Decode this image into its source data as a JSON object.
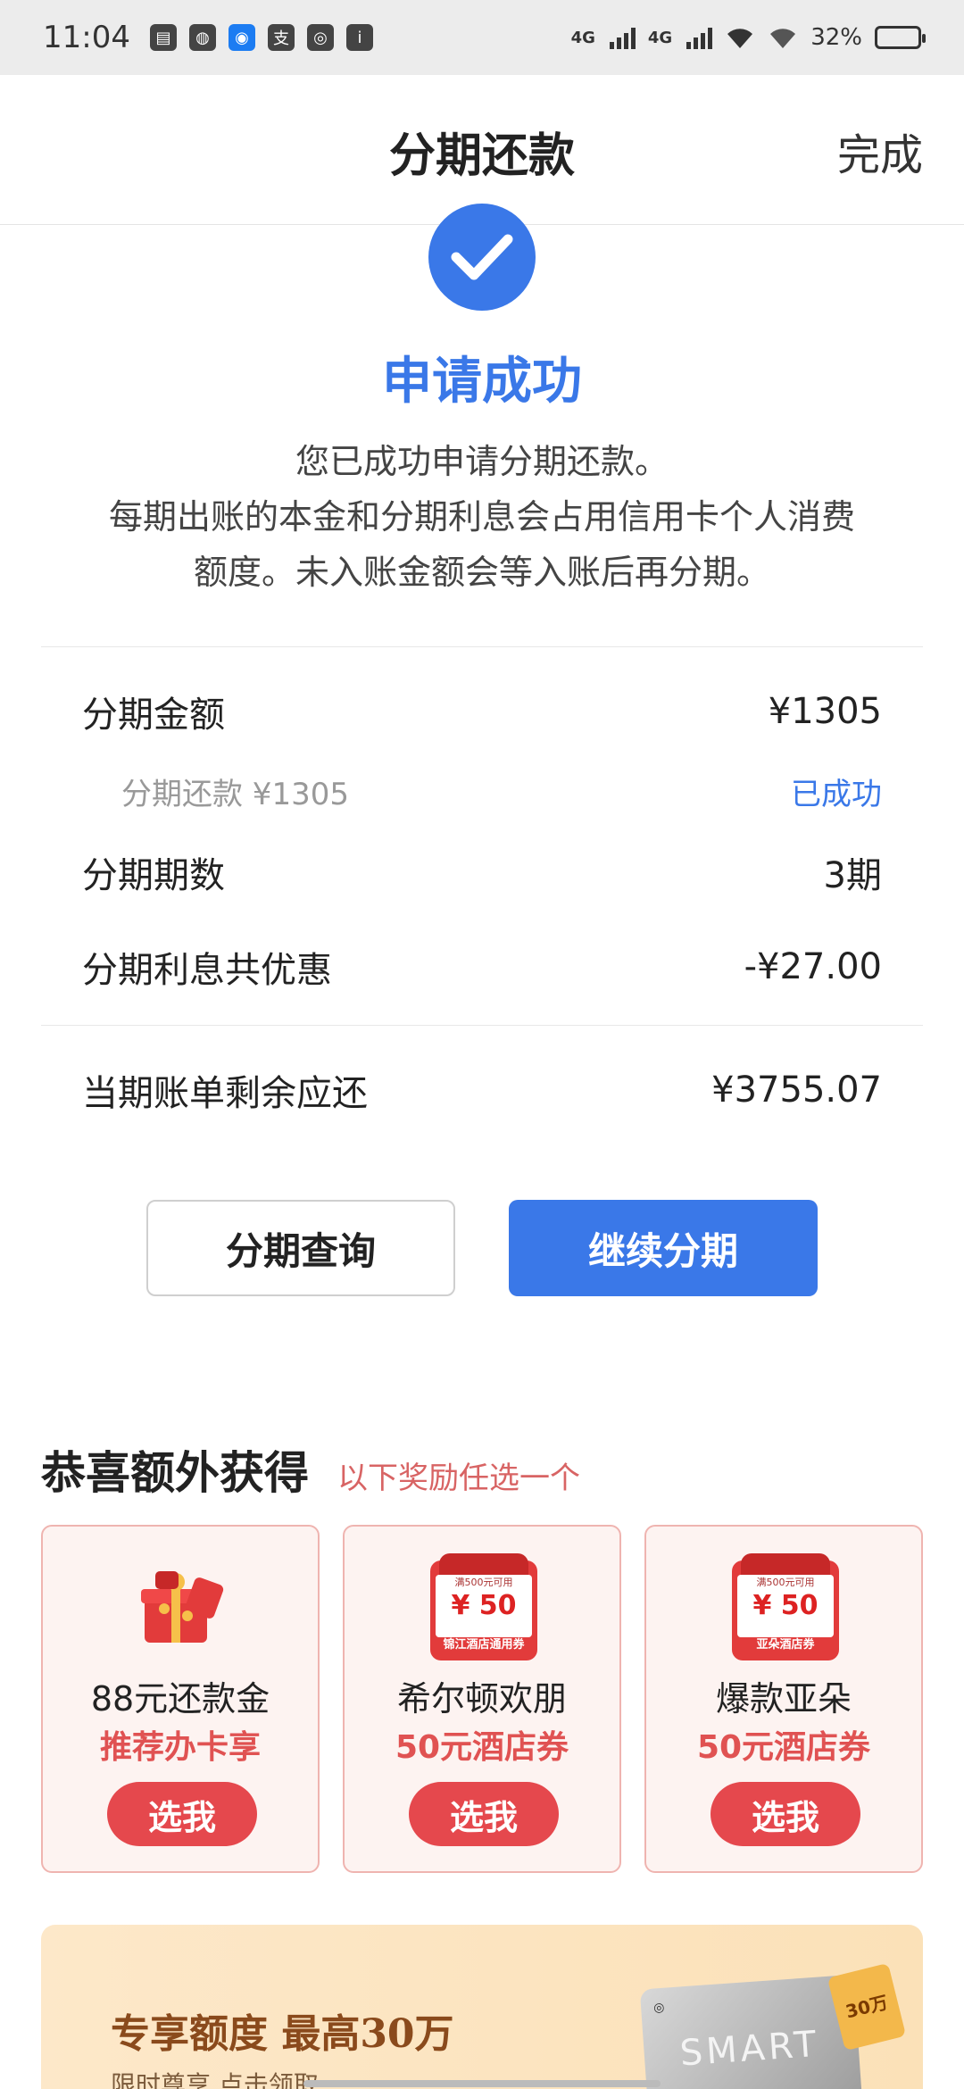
{
  "status_bar": {
    "time": "11:04",
    "net1": "4G",
    "net2": "4G",
    "battery_percent": "32%",
    "battery_level": 0.32
  },
  "nav": {
    "title": "分期还款",
    "done": "完成"
  },
  "success": {
    "title": "申请成功",
    "line1": "您已成功申请分期还款。",
    "line2": "每期出账的本金和分期利息会占用信用卡个人消费",
    "line3": "额度。未入账金额会等入账后再分期。"
  },
  "details": {
    "amount_label": "分期金额",
    "amount_value": "¥1305",
    "sub_label": "分期还款 ¥1305",
    "sub_status": "已成功",
    "periods_label": "分期期数",
    "periods_value": "3期",
    "discount_label": "分期利息共优惠",
    "discount_value": "-¥27.00",
    "remaining_label": "当期账单剩余应还",
    "remaining_value": "¥3755.07"
  },
  "buttons": {
    "query": "分期查询",
    "continue": "继续分期"
  },
  "rewards": {
    "title": "恭喜额外获得",
    "subtitle": "以下奖励任选一个",
    "items": [
      {
        "name": "88元还款金",
        "sub": "推荐办卡享",
        "button": "选我"
      },
      {
        "name": "希尔顿欢朋",
        "sub": "50元酒店券",
        "button": "选我",
        "coupon_top": "满500元可用",
        "coupon_amount": "¥ 50",
        "coupon_bottom": "锦江酒店通用券"
      },
      {
        "name": "爆款亚朵",
        "sub": "50元酒店券",
        "button": "选我",
        "coupon_top": "满500元可用",
        "coupon_amount": "¥ 50",
        "coupon_bottom": "亚朵酒店券"
      }
    ]
  },
  "banner": {
    "title": "专享额度 最高30万",
    "subtitle": "限时尊享 点击领取",
    "card_text": "SMART",
    "tag": "30万"
  }
}
